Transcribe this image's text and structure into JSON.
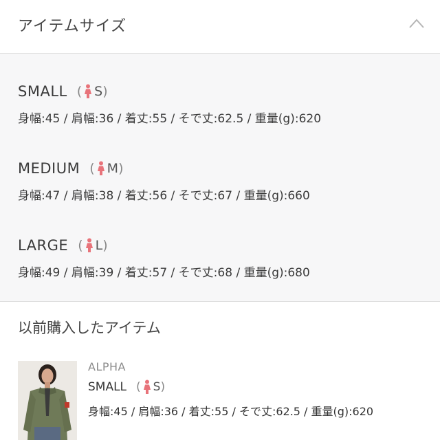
{
  "header": {
    "title": "アイテムサイズ",
    "toggle_icon": "chevron-up-icon"
  },
  "sizes": [
    {
      "name": "SMALL",
      "tag_open": "(",
      "tag_letter": "S",
      "tag_close": ")",
      "spec": "身幅:45 / 肩幅:36 / 着丈:55 / そで丈:62.5 / 重量(g):620"
    },
    {
      "name": "MEDIUM",
      "tag_open": "(",
      "tag_letter": "M",
      "tag_close": ")",
      "spec": "身幅:47 / 肩幅:38 / 着丈:56 / そで丈:67 / 重量(g):660"
    },
    {
      "name": "LARGE",
      "tag_open": "(",
      "tag_letter": "L",
      "tag_close": ")",
      "spec": "身幅:49 / 肩幅:39 / 着丈:57 / そで丈:68 / 重量(g):680"
    }
  ],
  "history": {
    "title": "以前購入したアイテム",
    "item": {
      "brand": "ALPHA",
      "size_name": "SMALL",
      "tag_open": "(",
      "tag_letter": "S",
      "tag_close": ")",
      "spec": "身幅:45 / 肩幅:36 / 着丈:55 / そで丈:62.5 / 重量(g):620"
    }
  },
  "colors": {
    "women_icon": "#e8737a",
    "divider": "#dedede",
    "section_bg": "#f7f7f8"
  }
}
